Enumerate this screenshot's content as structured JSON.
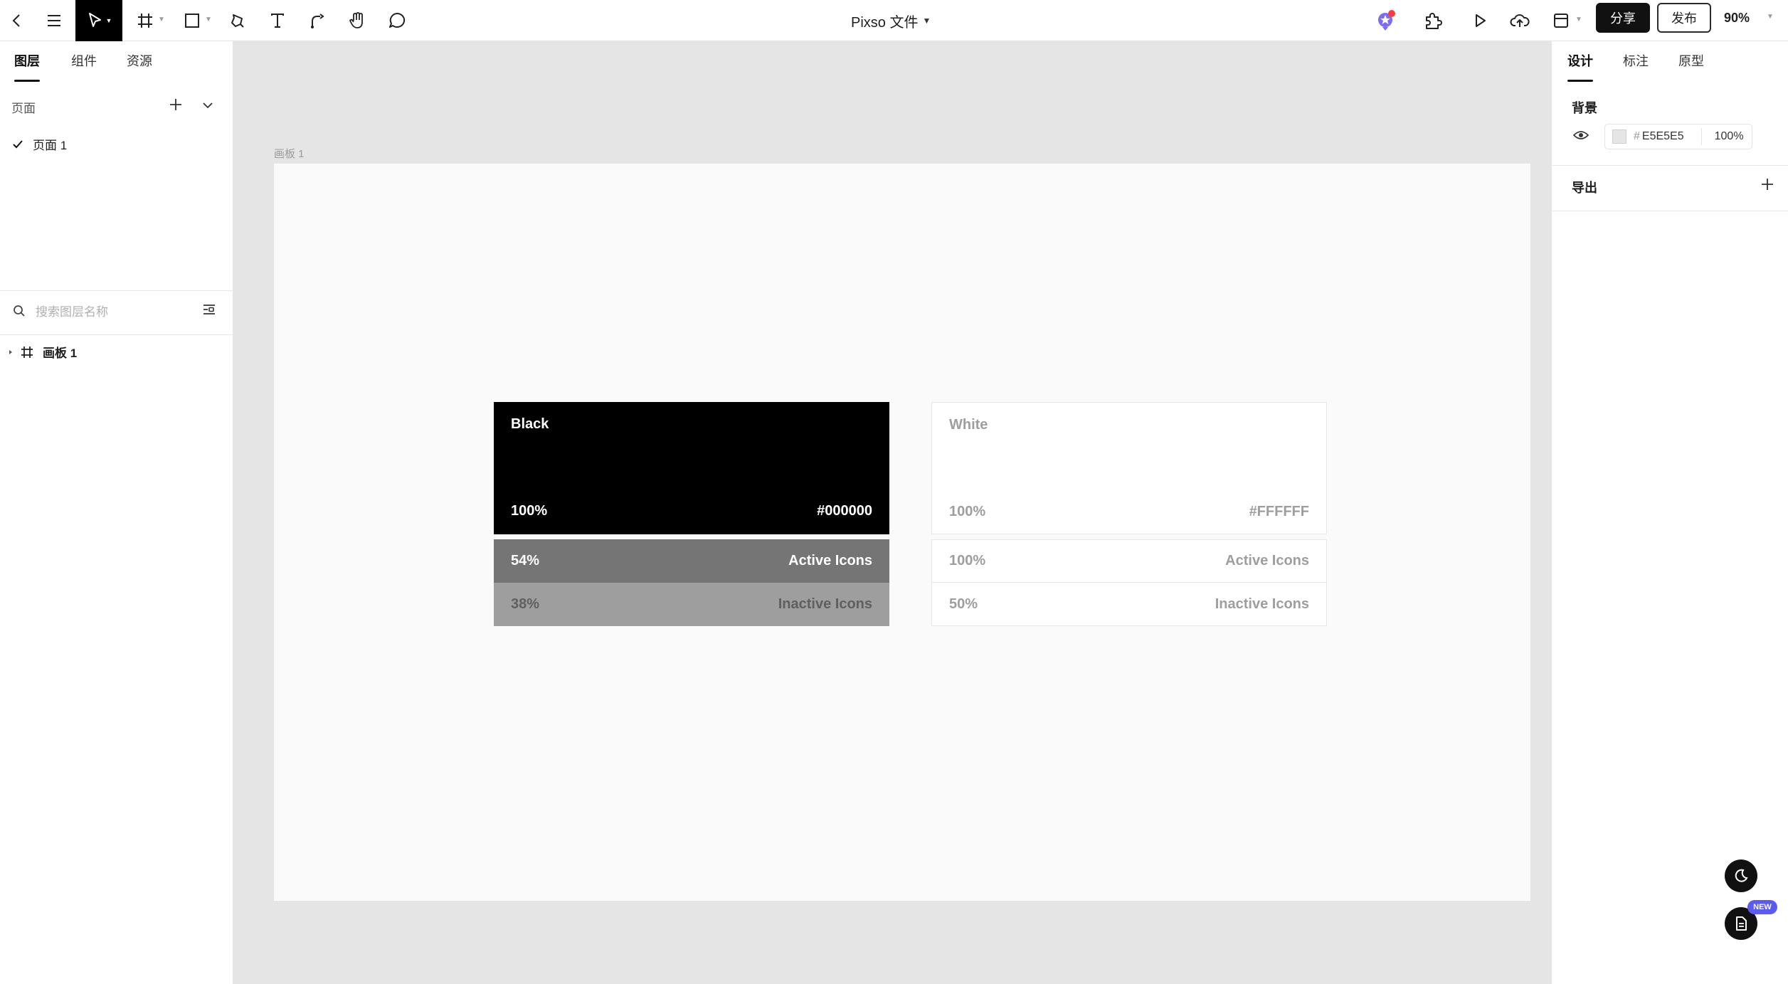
{
  "document": {
    "title": "Pixso 文件"
  },
  "toolbar": {
    "tools": [
      "back-icon",
      "menu-icon",
      "move-tool-icon",
      "frame-tool-icon",
      "shape-tool-icon",
      "pen-tool-icon",
      "text-tool-icon",
      "connector-tool-icon",
      "hand-tool-icon",
      "comment-tool-icon"
    ],
    "share_label": "分享",
    "publish_label": "发布",
    "zoom": "90%"
  },
  "left_panel": {
    "tabs": [
      {
        "label": "图层",
        "active": true
      },
      {
        "label": "组件",
        "active": false
      },
      {
        "label": "资源",
        "active": false
      }
    ],
    "pages_label": "页面",
    "pages": [
      {
        "label": "页面 1",
        "selected": true
      }
    ],
    "search_placeholder": "搜索图层名称",
    "layers": [
      {
        "label": "画板 1",
        "type": "frame"
      }
    ]
  },
  "right_panel": {
    "tabs": [
      {
        "label": "设计",
        "active": true
      },
      {
        "label": "标注",
        "active": false
      },
      {
        "label": "原型",
        "active": false
      }
    ],
    "background": {
      "title": "背景",
      "hash": "#",
      "hex": "E5E5E5",
      "opacity": "100%",
      "color": "#E5E5E5"
    },
    "export": {
      "title": "导出"
    }
  },
  "canvas": {
    "frame_label": "画板 1",
    "cards": [
      {
        "title": "Black",
        "opacity": "100%",
        "hex": "#000000",
        "rows": [
          {
            "pct": "54%",
            "label": "Active Icons"
          },
          {
            "pct": "38%",
            "label": "Inactive Icons"
          }
        ]
      },
      {
        "title": "White",
        "opacity": "100%",
        "hex": "#FFFFFF",
        "rows": [
          {
            "pct": "100%",
            "label": "Active Icons"
          },
          {
            "pct": "50%",
            "label": "Inactive Icons"
          }
        ]
      }
    ]
  },
  "floating": {
    "new_badge": "NEW"
  },
  "colors": {
    "accent": "#5b5bf0",
    "black_swatch": "#000000",
    "black_active": "#757575",
    "black_inactive": "#9e9e9e",
    "white_swatch": "#ffffff"
  }
}
